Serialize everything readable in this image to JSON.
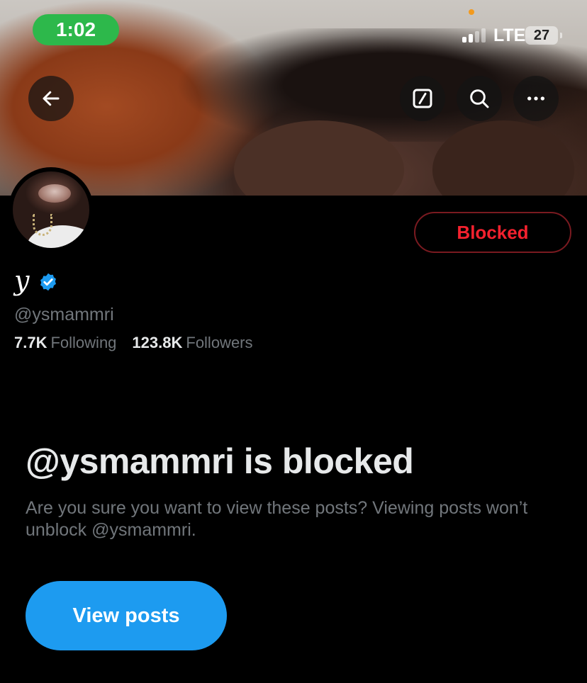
{
  "status_bar": {
    "time": "1:02",
    "network": "LTE",
    "battery": "27"
  },
  "header": {
    "back_icon": "arrow-left-icon",
    "compose_icon": "compose-icon",
    "search_icon": "search-icon",
    "more_icon": "more-icon"
  },
  "profile": {
    "display_name": "y",
    "verified": true,
    "handle": "@ysmammri",
    "following_count": "7.7K",
    "following_label": "Following",
    "followers_count": "123.8K",
    "followers_label": "Followers",
    "relationship_button": "Blocked"
  },
  "notice": {
    "title": "@ysmammri is blocked",
    "description": "Are you sure you want to view these posts? Viewing posts won’t unblock @ysmammri.",
    "view_button": "View posts"
  },
  "colors": {
    "accent_blue": "#1d9bf0",
    "blocked_red": "#f4212e",
    "time_pill_green": "#2db84b"
  }
}
